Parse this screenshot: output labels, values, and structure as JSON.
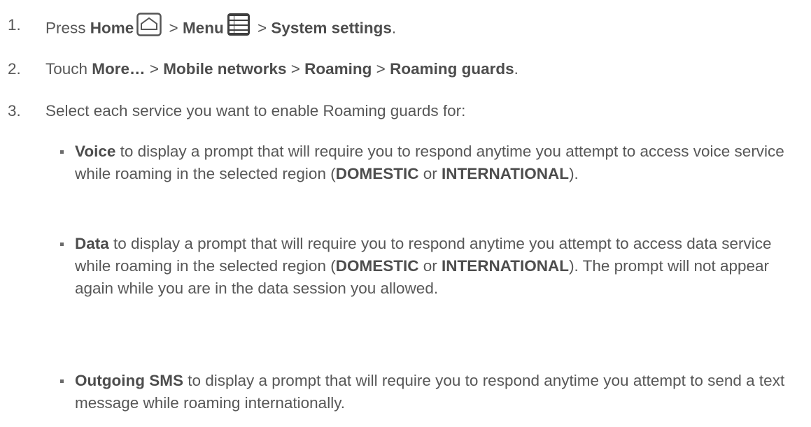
{
  "steps": [
    {
      "number": "1.",
      "t1": "Press ",
      "home": "Home",
      "sep1": " > ",
      "menu": "Menu",
      "sep2": " > ",
      "system": "System settings",
      "end": "."
    },
    {
      "number": "2.",
      "t1": "Touch ",
      "more": "More…",
      "sep1": " > ",
      "mobile": "Mobile networks",
      "sep2": " > ",
      "roaming": "Roaming",
      "sep3": " > ",
      "guards": "Roaming guards",
      "end": "."
    },
    {
      "number": "3.",
      "text": "Select each service you want to enable Roaming guards for:"
    }
  ],
  "bullets": [
    {
      "term": "Voice",
      "text1": " to display a prompt that will require you to respond anytime you attempt to access voice service while roaming in the selected region (",
      "dom": "DOMESTIC",
      "or": " or ",
      "intl": "INTERNATIONAL",
      "text2": ")."
    },
    {
      "term": "Data",
      "text1": " to display a prompt that will require you to respond anytime you attempt to access data service while roaming in the selected region (",
      "dom": "DOMESTIC",
      "or": " or ",
      "intl": "INTERNATIONAL",
      "text2": "). The prompt will not appear again while you are in the data session you allowed."
    },
    {
      "term": "Outgoing SMS",
      "text1": " to display a prompt that will require you to respond anytime you attempt to send a text message while roaming internationally."
    }
  ],
  "icons": {
    "home": "home-icon",
    "menu": "menu-icon"
  }
}
